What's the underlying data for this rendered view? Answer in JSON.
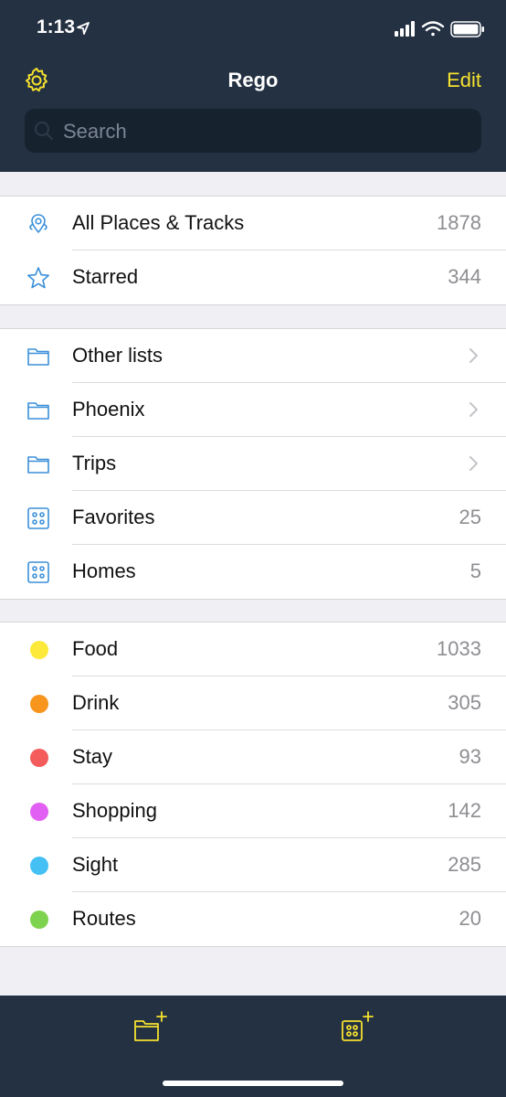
{
  "status": {
    "time": "1:13"
  },
  "nav": {
    "title": "Rego",
    "edit_label": "Edit"
  },
  "search": {
    "placeholder": "Search"
  },
  "groups": [
    {
      "rows": [
        {
          "icon": "pin-map-icon",
          "label": "All Places & Tracks",
          "count": "1878"
        },
        {
          "icon": "star-icon",
          "label": "Starred",
          "count": "344"
        }
      ]
    },
    {
      "rows": [
        {
          "icon": "folder-icon",
          "label": "Other lists",
          "chevron": true
        },
        {
          "icon": "folder-icon",
          "label": "Phoenix",
          "chevron": true
        },
        {
          "icon": "folder-icon",
          "label": "Trips",
          "chevron": true
        },
        {
          "icon": "list-grid-icon",
          "label": "Favorites",
          "count": "25"
        },
        {
          "icon": "list-grid-icon",
          "label": "Homes",
          "count": "5"
        }
      ]
    },
    {
      "rows": [
        {
          "color": "#fde93a",
          "label": "Food",
          "count": "1033"
        },
        {
          "color": "#f7951d",
          "label": "Drink",
          "count": "305"
        },
        {
          "color": "#f45b5b",
          "label": "Stay",
          "count": "93"
        },
        {
          "color": "#e25ff3",
          "label": "Shopping",
          "count": "142"
        },
        {
          "color": "#45c0f5",
          "label": "Sight",
          "count": "285"
        },
        {
          "color": "#7ed34e",
          "label": "Routes",
          "count": "20"
        }
      ]
    }
  ],
  "colors": {
    "accent": "#f5e12e",
    "icon_blue": "#3a8fd9",
    "header_bg": "#243142"
  }
}
